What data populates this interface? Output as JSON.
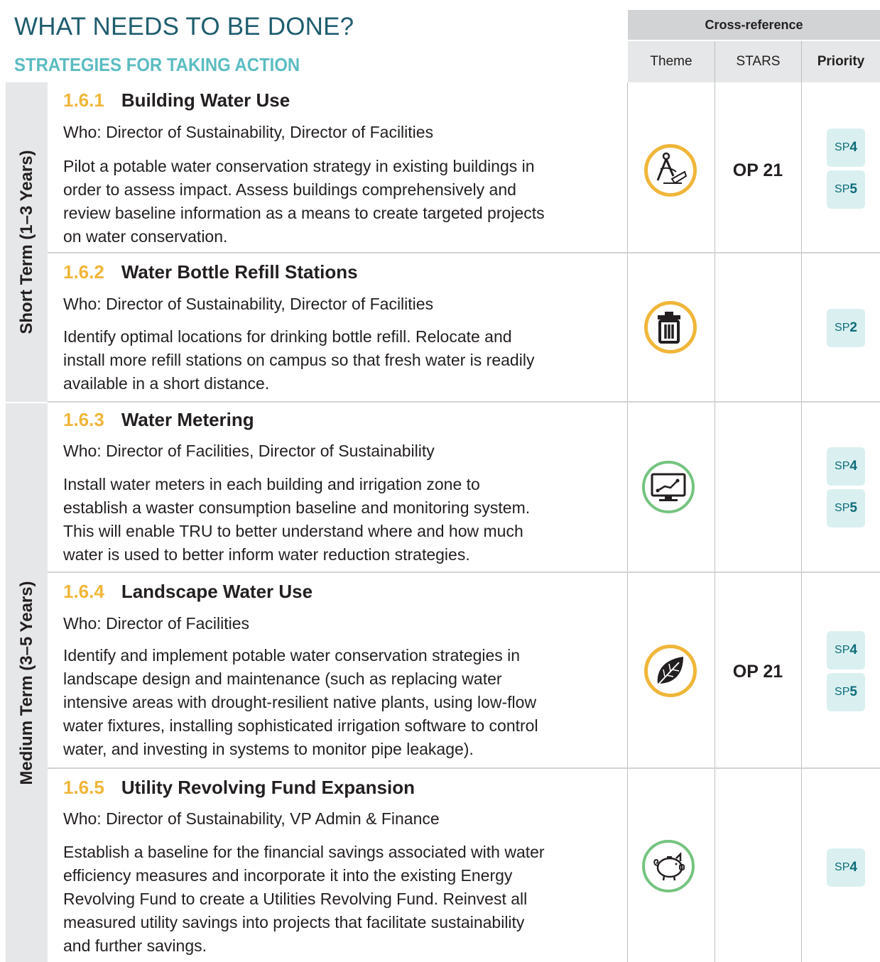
{
  "header": {
    "title": "WHAT NEEDS TO BE DONE?",
    "subtitle": "STRATEGIES FOR TAKING ACTION"
  },
  "crossref": {
    "label": "Cross-reference",
    "columns": [
      "Theme",
      "STARS",
      "Priority"
    ]
  },
  "terms": [
    {
      "label": "Short Term (1–3 Years)"
    },
    {
      "label": "Medium Term (3–5 Years)"
    }
  ],
  "strategies": [
    {
      "number": "1.6.1",
      "title": "Building Water Use",
      "who": "Who: Director of Sustainability, Director of Facilities",
      "lines": [
        "Pilot a potable water conservation strategy in existing buildings in",
        "order to assess impact. Assess buildings comprehensively and",
        "review baseline information as a means to create targeted projects",
        "on water conservation."
      ],
      "theme_icon": "design-tools-icon",
      "stars": "OP 21",
      "priorities": [
        {
          "prefix": "SP",
          "num": "4"
        },
        {
          "prefix": "SP",
          "num": "5"
        }
      ]
    },
    {
      "number": "1.6.2",
      "title": "Water Bottle Refill Stations",
      "who": "Who: Director of Sustainability, Director of Facilities",
      "lines": [
        "Identify optimal locations for drinking bottle refill. Relocate and",
        "install more refill stations on campus so that fresh water is readily",
        "available in a short distance."
      ],
      "theme_icon": "trash-bin-icon",
      "stars": "",
      "priorities": [
        {
          "prefix": "SP",
          "num": "2"
        }
      ]
    },
    {
      "number": "1.6.3",
      "title": "Water Metering",
      "who": "Who: Director of Facilities, Director of Sustainability",
      "lines": [
        "Install water meters in each building and irrigation zone to",
        "establish a waster consumption baseline and monitoring system.",
        "This will enable TRU to better understand where and how much",
        "water is used to better inform water reduction strategies."
      ],
      "theme_icon": "monitor-chart-icon",
      "stars": "",
      "priorities": [
        {
          "prefix": "SP",
          "num": "4"
        },
        {
          "prefix": "SP",
          "num": "5"
        }
      ]
    },
    {
      "number": "1.6.4",
      "title": "Landscape Water Use",
      "who": "Who: Director of Facilities",
      "lines": [
        "Identify and implement potable water conservation strategies in",
        "landscape design and maintenance (such as replacing water",
        "intensive areas with drought-resilient native plants, using low-flow",
        "water fixtures, installing sophisticated irrigation software to control",
        "water, and investing in systems to monitor pipe leakage)."
      ],
      "theme_icon": "leaf-icon",
      "stars": "OP 21",
      "priorities": [
        {
          "prefix": "SP",
          "num": "4"
        },
        {
          "prefix": "SP",
          "num": "5"
        }
      ]
    },
    {
      "number": "1.6.5",
      "title": "Utility Revolving Fund Expansion",
      "who": "Who: Director of Sustainability, VP Admin & Finance",
      "lines": [
        "Establish a baseline for the financial savings associated with water",
        "efficiency measures and incorporate it into the existing Energy",
        "Revolving Fund to create a Utilities Revolving Fund. Reinvest all",
        "measured utility savings into projects that facilitate sustainability",
        "and further savings."
      ],
      "theme_icon": "piggy-bank-icon",
      "stars": "",
      "priorities": [
        {
          "prefix": "SP",
          "num": "4"
        }
      ]
    }
  ]
}
